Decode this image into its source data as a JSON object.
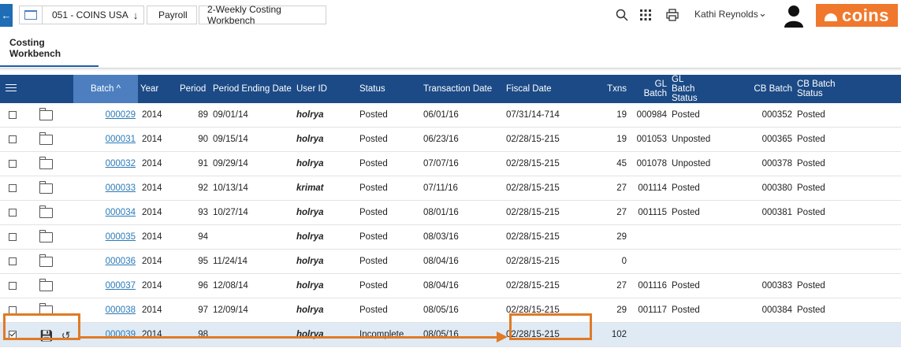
{
  "breadcrumb": {
    "company": "051 - COINS USA",
    "module": "Payroll",
    "page": "2-Weekly Costing Workbench"
  },
  "user": {
    "name": "Kathi Reynolds"
  },
  "logo": {
    "text": "coins",
    "color": "#f0782d"
  },
  "tabs": [
    {
      "label": "Costing Workbench"
    }
  ],
  "table": {
    "columns": [
      "Batch",
      "Year",
      "Period",
      "Period Ending Date",
      "User ID",
      "Status",
      "Transaction Date",
      "Fiscal Date",
      "Txns",
      "GL Batch",
      "GL Batch Status",
      "CB Batch",
      "CB Batch Status"
    ],
    "sort_indicator": "^",
    "rows": [
      {
        "batch": "000029",
        "year": "2014",
        "period": "89",
        "ped": "09/01/14",
        "user": "holrya",
        "status": "Posted",
        "txdate": "06/01/16",
        "fiscal": "07/31/14-714",
        "txns": "19",
        "gl": "000984",
        "glstatus": "Posted",
        "cb": "000352",
        "cbstatus": "Posted"
      },
      {
        "batch": "000031",
        "year": "2014",
        "period": "90",
        "ped": "09/15/14",
        "user": "holrya",
        "status": "Posted",
        "txdate": "06/23/16",
        "fiscal": "02/28/15-215",
        "txns": "19",
        "gl": "001053",
        "glstatus": "Unposted",
        "cb": "000365",
        "cbstatus": "Posted"
      },
      {
        "batch": "000032",
        "year": "2014",
        "period": "91",
        "ped": "09/29/14",
        "user": "holrya",
        "status": "Posted",
        "txdate": "07/07/16",
        "fiscal": "02/28/15-215",
        "txns": "45",
        "gl": "001078",
        "glstatus": "Unposted",
        "cb": "000378",
        "cbstatus": "Posted"
      },
      {
        "batch": "000033",
        "year": "2014",
        "period": "92",
        "ped": "10/13/14",
        "user": "krimat",
        "status": "Posted",
        "txdate": "07/11/16",
        "fiscal": "02/28/15-215",
        "txns": "27",
        "gl": "001114",
        "glstatus": "Posted",
        "cb": "000380",
        "cbstatus": "Posted"
      },
      {
        "batch": "000034",
        "year": "2014",
        "period": "93",
        "ped": "10/27/14",
        "user": "holrya",
        "status": "Posted",
        "txdate": "08/01/16",
        "fiscal": "02/28/15-215",
        "txns": "27",
        "gl": "001115",
        "glstatus": "Posted",
        "cb": "000381",
        "cbstatus": "Posted"
      },
      {
        "batch": "000035",
        "year": "2014",
        "period": "94",
        "ped": "",
        "user": "holrya",
        "status": "Posted",
        "txdate": "08/03/16",
        "fiscal": "02/28/15-215",
        "txns": "29",
        "gl": "",
        "glstatus": "",
        "cb": "",
        "cbstatus": ""
      },
      {
        "batch": "000036",
        "year": "2014",
        "period": "95",
        "ped": "11/24/14",
        "user": "holrya",
        "status": "Posted",
        "txdate": "08/04/16",
        "fiscal": "02/28/15-215",
        "txns": "0",
        "gl": "",
        "glstatus": "",
        "cb": "",
        "cbstatus": ""
      },
      {
        "batch": "000037",
        "year": "2014",
        "period": "96",
        "ped": "12/08/14",
        "user": "holrya",
        "status": "Posted",
        "txdate": "08/04/16",
        "fiscal": "02/28/15-215",
        "txns": "27",
        "gl": "001116",
        "glstatus": "Posted",
        "cb": "000383",
        "cbstatus": "Posted"
      },
      {
        "batch": "000038",
        "year": "2014",
        "period": "97",
        "ped": "12/09/14",
        "user": "holrya",
        "status": "Posted",
        "txdate": "08/05/16",
        "fiscal": "02/28/15-215",
        "txns": "29",
        "gl": "001117",
        "glstatus": "Posted",
        "cb": "000384",
        "cbstatus": "Posted"
      },
      {
        "batch": "000039",
        "year": "2014",
        "period": "98",
        "ped": "",
        "user": "holrya",
        "status": "Incomplete",
        "txdate": "08/05/16",
        "fiscal": "02/28/15-215",
        "txns": "102",
        "gl": "",
        "glstatus": "",
        "cb": "",
        "cbstatus": "",
        "selected": true
      }
    ]
  },
  "colors": {
    "header_bg": "#1b4a86",
    "sorted_header": "#4d7fc0",
    "annotation": "#e07a25",
    "link": "#2a7ab8"
  }
}
